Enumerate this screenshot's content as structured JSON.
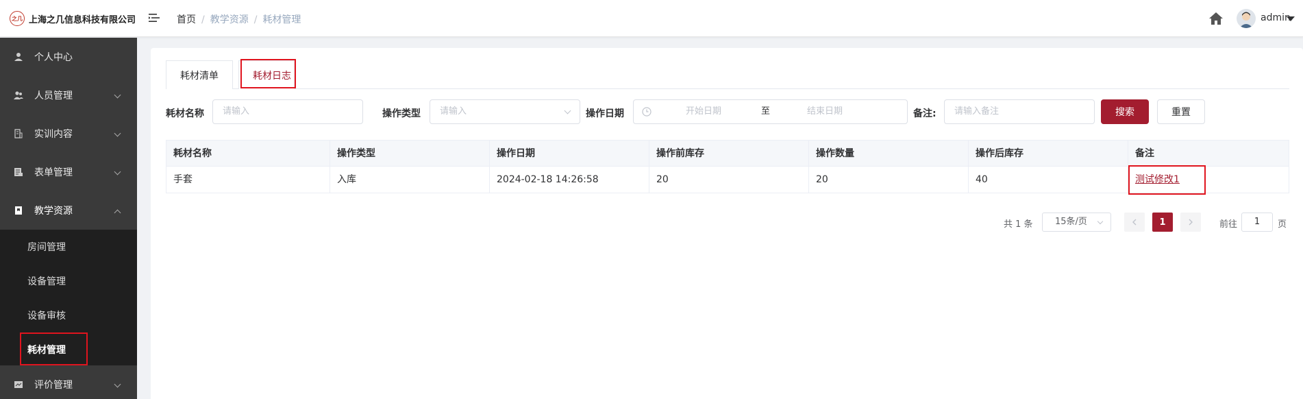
{
  "header": {
    "company": "上海之几信息科技有限公司",
    "logo_text": "之几",
    "breadcrumb": [
      "首页",
      "教学资源",
      "耗材管理"
    ],
    "user": "admin"
  },
  "sidebar": {
    "items": [
      {
        "label": "个人中心",
        "icon": "user-icon"
      },
      {
        "label": "人员管理",
        "icon": "users-icon"
      },
      {
        "label": "实训内容",
        "icon": "book-icon"
      },
      {
        "label": "表单管理",
        "icon": "form-icon"
      },
      {
        "label": "教学资源",
        "icon": "resource-icon"
      },
      {
        "label": "评价管理",
        "icon": "rating-icon"
      }
    ],
    "sub_items": [
      "房间管理",
      "设备管理",
      "设备审核",
      "耗材管理"
    ]
  },
  "tabs": [
    "耗材清单",
    "耗材日志"
  ],
  "filters": {
    "name_label": "耗材名称",
    "name_placeholder": "请输入",
    "type_label": "操作类型",
    "type_placeholder": "请输入",
    "date_label": "操作日期",
    "date_start": "开始日期",
    "date_sep": "至",
    "date_end": "结束日期",
    "note_label": "备注:",
    "note_placeholder": "请输入备注",
    "search_btn": "搜索",
    "reset_btn": "重置"
  },
  "table": {
    "columns": [
      "耗材名称",
      "操作类型",
      "操作日期",
      "操作前库存",
      "操作数量",
      "操作后库存",
      "备注"
    ],
    "rows": [
      [
        "手套",
        "入库",
        "2024-02-18 14:26:58",
        "20",
        "20",
        "40",
        "测试修改1"
      ]
    ]
  },
  "pagination": {
    "total": "共 1 条",
    "page_size": "15条/页",
    "current": "1",
    "goto_label": "前往",
    "goto_value": "1",
    "page_suffix": "页"
  },
  "colors": {
    "accent": "#a31d2f",
    "sidebar": "#3a3a3a",
    "highlight_box": "#e0141e"
  }
}
